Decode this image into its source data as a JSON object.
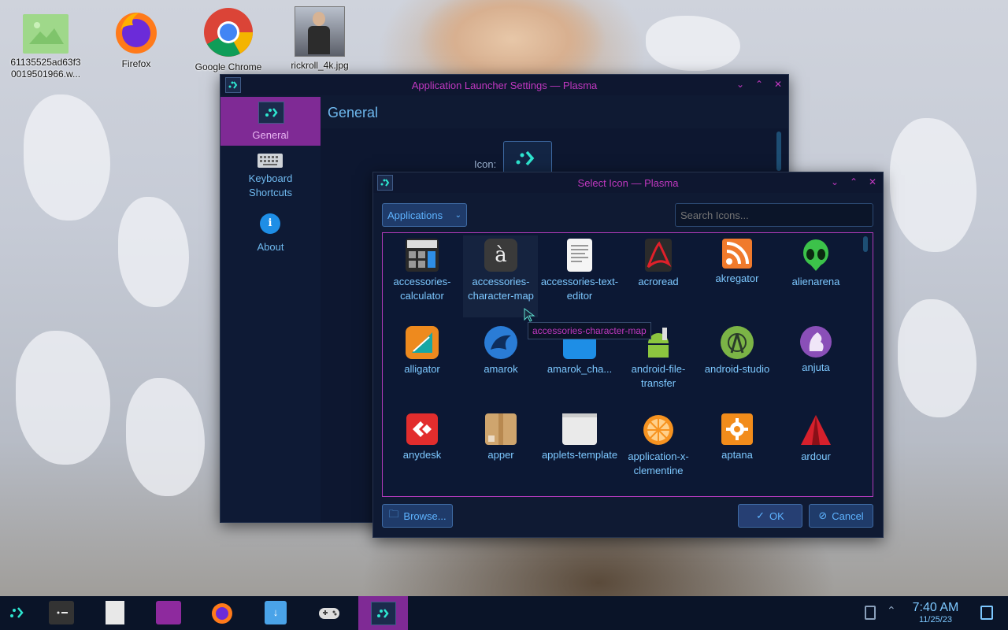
{
  "desktop": {
    "icons": [
      {
        "label": "61135525ad63f3 0019501966.w...",
        "icon": "image-file-icon"
      },
      {
        "label": "Firefox",
        "icon": "firefox-icon"
      },
      {
        "label": "Google Chrome",
        "icon": "chrome-icon"
      },
      {
        "label": "rickroll_4k.jpg",
        "icon": "image-thumbnail"
      }
    ]
  },
  "settings_window": {
    "title": "Application Launcher Settings — Plasma",
    "sidebar": [
      {
        "label": "General",
        "icon": "launcher-icon"
      },
      {
        "label": "Keyboard\nShortcuts",
        "icon": "keyboard-icon"
      },
      {
        "label": "About",
        "icon": "info-icon"
      }
    ],
    "heading": "General",
    "icon_label": "Icon:"
  },
  "icon_dialog": {
    "title": "Select Icon — Plasma",
    "category": "Applications",
    "search_placeholder": "Search Icons...",
    "icons": [
      {
        "label": "accessories-calculator"
      },
      {
        "label": "accessories-character-map"
      },
      {
        "label": "accessories-text-editor"
      },
      {
        "label": "acroread"
      },
      {
        "label": "akregator"
      },
      {
        "label": "alienarena"
      },
      {
        "label": "alligator"
      },
      {
        "label": "amarok"
      },
      {
        "label": "amarok_cha..."
      },
      {
        "label": "android-file-transfer"
      },
      {
        "label": "android-studio"
      },
      {
        "label": "anjuta"
      },
      {
        "label": "anydesk"
      },
      {
        "label": "apper"
      },
      {
        "label": "applets-template"
      },
      {
        "label": "application-x-clementine"
      },
      {
        "label": "aptana"
      },
      {
        "label": "ardour"
      }
    ],
    "tooltip": "accessories-character-map",
    "browse_label": "Browse...",
    "ok_label": "OK",
    "cancel_label": "Cancel"
  },
  "taskbar": {
    "time": "7:40 AM",
    "date": "11/25/23"
  },
  "colors": {
    "accent": "#8e2a9e",
    "window_bg": "#0f1a33",
    "title_text": "#c038c0",
    "link_text": "#7dc8ff"
  }
}
